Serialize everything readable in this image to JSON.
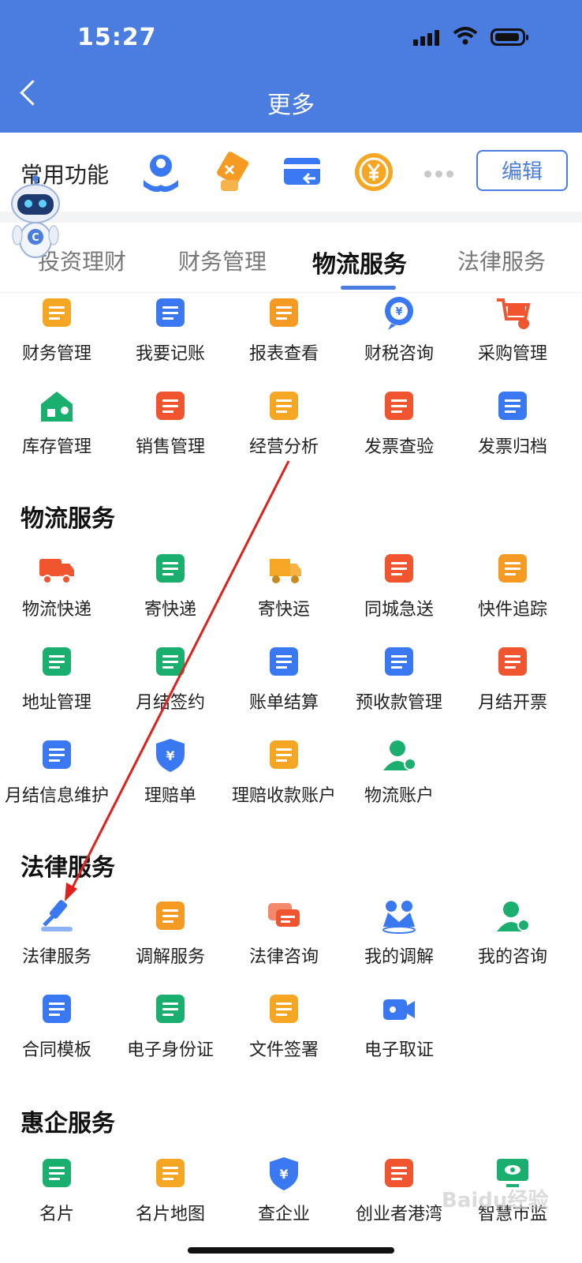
{
  "status": {
    "time": "15:27"
  },
  "header": {
    "title": "更多"
  },
  "quick": {
    "label": "常用功能",
    "edit": "编辑",
    "icons": [
      {
        "name": "hand-user-icon",
        "color": "#3a78f2"
      },
      {
        "name": "ticket-hand-icon",
        "color": "#f59a23"
      },
      {
        "name": "card-return-icon",
        "color": "#3a78f2"
      },
      {
        "name": "yen-coin-icon",
        "color": "#f5a623"
      }
    ]
  },
  "tabs": [
    {
      "label": "投资理财"
    },
    {
      "label": "财务管理"
    },
    {
      "label": "物流服务"
    },
    {
      "label": "法律服务"
    }
  ],
  "active_tab": "物流服务",
  "finance": {
    "items": [
      {
        "label": "财务管理",
        "icon": "ledger-yen-icon",
        "color": "#f5a623"
      },
      {
        "label": "我要记账",
        "icon": "bill-pen-icon",
        "color": "#3a78f2"
      },
      {
        "label": "报表查看",
        "icon": "report-icon",
        "color": "#f59a23"
      },
      {
        "label": "财税咨询",
        "icon": "yen-chat-icon",
        "color": "#3a78f2"
      },
      {
        "label": "采购管理",
        "icon": "cart-gear-icon",
        "color": "#f0552f"
      },
      {
        "label": "库存管理",
        "icon": "warehouse-icon",
        "color": "#1aae6f"
      },
      {
        "label": "销售管理",
        "icon": "briefcase-icon",
        "color": "#f0552f"
      },
      {
        "label": "经营分析",
        "icon": "calendar-chart-icon",
        "color": "#f5a623"
      },
      {
        "label": "发票查验",
        "icon": "invoice-check-icon",
        "color": "#f0552f"
      },
      {
        "label": "发票归档",
        "icon": "archive-icon",
        "color": "#3a78f2"
      }
    ]
  },
  "logistics": {
    "title": "物流服务",
    "items": [
      {
        "label": "物流快递",
        "icon": "truck-icon",
        "color": "#f0552f"
      },
      {
        "label": "寄快递",
        "icon": "package-icon",
        "color": "#1aae6f"
      },
      {
        "label": "寄快运",
        "icon": "van-icon",
        "color": "#f5a623"
      },
      {
        "label": "同城急送",
        "icon": "building-clock-icon",
        "color": "#f0552f"
      },
      {
        "label": "快件追踪",
        "icon": "wallet-track-icon",
        "color": "#f59a23"
      },
      {
        "label": "地址管理",
        "icon": "address-book-icon",
        "color": "#1aae6f"
      },
      {
        "label": "月结签约",
        "icon": "handshake-icon",
        "color": "#1aae6f"
      },
      {
        "label": "账单结算",
        "icon": "bill-envelope-icon",
        "color": "#3a78f2"
      },
      {
        "label": "预收款管理",
        "icon": "clipboard-yen-icon",
        "color": "#3a78f2"
      },
      {
        "label": "月结开票",
        "icon": "printer-icon",
        "color": "#f0552f"
      },
      {
        "label": "月结信息维护",
        "icon": "doc-search-icon",
        "color": "#3a78f2"
      },
      {
        "label": "理赔单",
        "icon": "shield-yen-icon",
        "color": "#3a78f2"
      },
      {
        "label": "理赔收款账户",
        "icon": "clipboard-user-icon",
        "color": "#f5a623"
      },
      {
        "label": "物流账户",
        "icon": "user-box-icon",
        "color": "#1aae6f"
      }
    ]
  },
  "legal": {
    "title": "法律服务",
    "items": [
      {
        "label": "法律服务",
        "icon": "gavel-icon",
        "color": "#3a78f2"
      },
      {
        "label": "调解服务",
        "icon": "notebook-user-icon",
        "color": "#f59a23"
      },
      {
        "label": "法律咨询",
        "icon": "chat-bubbles-icon",
        "color": "#f0552f"
      },
      {
        "label": "我的调解",
        "icon": "people-m-icon",
        "color": "#3a78f2"
      },
      {
        "label": "我的咨询",
        "icon": "user-question-icon",
        "color": "#1aae6f"
      },
      {
        "label": "合同模板",
        "icon": "contract-icon",
        "color": "#3a78f2"
      },
      {
        "label": "电子身份证",
        "icon": "id-card-icon",
        "color": "#1aae6f"
      },
      {
        "label": "文件签署",
        "icon": "doc-sign-icon",
        "color": "#f5a623"
      },
      {
        "label": "电子取证",
        "icon": "video-icon",
        "color": "#3a78f2"
      }
    ]
  },
  "benefit": {
    "title": "惠企服务",
    "items": [
      {
        "label": "名片",
        "icon": "card-user-icon",
        "color": "#1aae6f"
      },
      {
        "label": "名片地图",
        "icon": "map-search-icon",
        "color": "#f5a623"
      },
      {
        "label": "查企业",
        "icon": "shield-company-icon",
        "color": "#3a78f2"
      },
      {
        "label": "创业者港湾",
        "icon": "harbor-logo-icon",
        "color": "#f0552f"
      },
      {
        "label": "智慧市监",
        "icon": "monitor-eye-icon",
        "color": "#1aae6f"
      }
    ]
  },
  "watermark": "Baidu经验"
}
